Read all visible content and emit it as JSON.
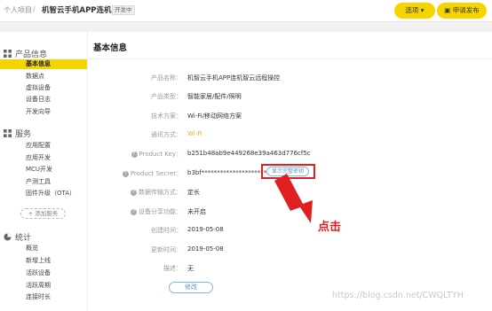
{
  "header": {
    "breadcrumb_root": "个人项目",
    "separator": "/",
    "project_name": "机智云手机APP连机...",
    "status_badge": "开发中",
    "options_label": "选项 ▾",
    "publish_label": "申请发布"
  },
  "sidebar": {
    "sections": [
      {
        "title": "产品信息",
        "icon": "grid-icon"
      },
      {
        "title": "服务",
        "icon": "grid-icon"
      },
      {
        "title": "统计",
        "icon": "pie-chart-icon"
      }
    ],
    "product_items": [
      {
        "label": "基本信息",
        "active": true
      },
      {
        "label": "数据点"
      },
      {
        "label": "虚拟设备"
      },
      {
        "label": "设备日志"
      },
      {
        "label": "开发向导"
      }
    ],
    "service_items": [
      {
        "label": "应用配置"
      },
      {
        "label": "应用开发"
      },
      {
        "label": "MCU开发"
      },
      {
        "label": "产测工具"
      },
      {
        "label": "固件升级（OTA）"
      }
    ],
    "add_service_label": "+ 添加服务",
    "stat_items": [
      {
        "label": "概览"
      },
      {
        "label": "新增上线"
      },
      {
        "label": "活跃设备"
      },
      {
        "label": "活跃周期"
      },
      {
        "label": "连接时长"
      }
    ]
  },
  "main": {
    "title": "基本信息",
    "rows": [
      {
        "label": "产品名称：",
        "value": "机智云手机APP连机智云远程操控"
      },
      {
        "label": "产品类型：",
        "value": "智能家居/配件/照明"
      },
      {
        "label": "技术方案：",
        "value": "Wi-Fi/移动网络方案"
      },
      {
        "label": "通讯方式：",
        "value": "Wi-Fi"
      },
      {
        "label": "Product Key：",
        "value": "b251b48ab9e449268e39a463d776cf5c"
      },
      {
        "label": "Product Secret：",
        "value": "b3bf*********************5bd2"
      },
      {
        "label": "数据传输方式：",
        "value": "定长"
      },
      {
        "label": "设备分享功能：",
        "value": "未开启"
      },
      {
        "label": "创建时间：",
        "value": "2019-05-08"
      },
      {
        "label": "更新时间：",
        "value": "2019-05-08"
      },
      {
        "label": "描述：",
        "value": "无"
      }
    ],
    "show_secret_label": "显示完整密钥",
    "modify_label": "修改"
  },
  "annotation": {
    "text": "点击"
  },
  "watermark": "https://blog.csdn.net/CWQLTYH",
  "colors": {
    "accent": "#f5d400",
    "annotation": "#e02020",
    "link": "#5b95bd",
    "wifi": "#f5a623"
  }
}
